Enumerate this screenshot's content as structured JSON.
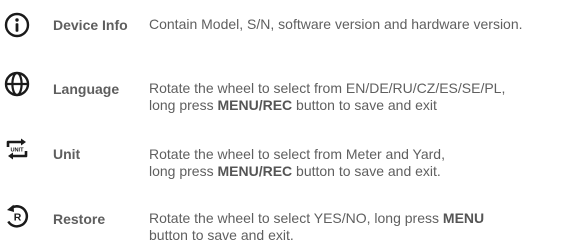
{
  "items": [
    {
      "icon": "info-circle-icon",
      "label": "Device Info",
      "line1": [
        {
          "t": "Contain Model, S/N, software version and hardware version."
        }
      ],
      "line2": []
    },
    {
      "icon": "globe-icon",
      "label": "Language",
      "line1": [
        {
          "t": "Rotate the wheel to select from EN/DE/RU/CZ/ES/SE/PL,"
        }
      ],
      "line2": [
        {
          "t": "long press "
        },
        {
          "t": "MENU/REC",
          "b": true
        },
        {
          "t": " button to save and exit"
        }
      ]
    },
    {
      "icon": "unit-switch-icon",
      "icon_text": "UNIT",
      "label": "Unit",
      "line1": [
        {
          "t": "Rotate the wheel to select from Meter and Yard,"
        }
      ],
      "line2": [
        {
          "t": "long press "
        },
        {
          "t": "MENU/REC",
          "b": true
        },
        {
          "t": " button to save and exit."
        }
      ]
    },
    {
      "icon": "restore-icon",
      "icon_text": "R",
      "label": "Restore",
      "line1": [
        {
          "t": "Rotate the wheel  to select YES/NO, long press "
        },
        {
          "t": "MENU",
          "b": true
        }
      ],
      "line2": [
        {
          "t": "button to save and exit."
        }
      ]
    }
  ]
}
